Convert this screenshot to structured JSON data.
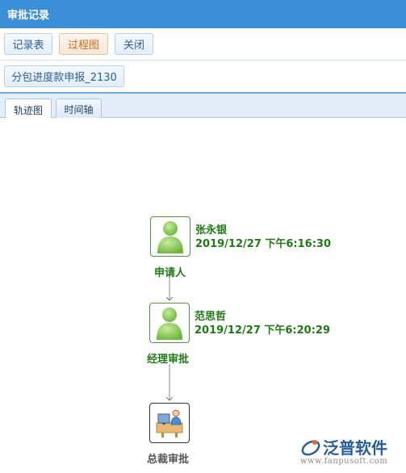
{
  "window": {
    "title": "审批记录"
  },
  "toolbar": {
    "record_table_label": "记录表",
    "process_chart_label": "过程图",
    "close_label": "关闭"
  },
  "document": {
    "label": "分包进度款申报_2130"
  },
  "tabs": [
    {
      "label": "轨迹图",
      "selected": true
    },
    {
      "label": "时间轴",
      "selected": false
    }
  ],
  "flow": {
    "nodes": [
      {
        "step": "申请人",
        "person": "张永银",
        "time": "2019/12/27 下午6:16:30",
        "icon": "user-icon",
        "status": "done"
      },
      {
        "step": "经理审批",
        "person": "范思哲",
        "time": "2019/12/27 下午6:20:29",
        "icon": "user-icon",
        "status": "done"
      },
      {
        "step": "总裁审批",
        "person": "",
        "time": "",
        "icon": "office-worker-icon",
        "status": "pending"
      }
    ]
  },
  "watermark": {
    "brand": "泛普软件",
    "url": "www.fanpusoft.com"
  },
  "colors": {
    "title_bar": "#3b8fd9",
    "done_text": "#1f7a14",
    "pending_text": "#555555"
  }
}
